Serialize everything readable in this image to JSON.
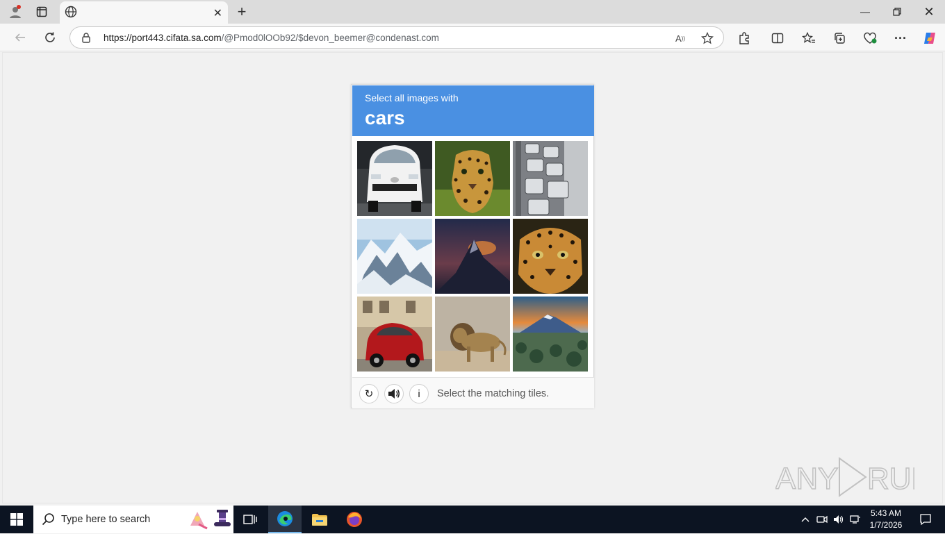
{
  "browser": {
    "tab_title": "",
    "url_host": "https://port443.cifata.sa.com",
    "url_path": "/@Pmod0lOOb92/$devon_beemer@condenast.com"
  },
  "captcha": {
    "prompt_line1": "Select all images with",
    "prompt_target": "cars",
    "footer_message": "Select the matching tiles.",
    "refresh_glyph": "↻",
    "info_glyph": "i",
    "tiles": [
      {
        "subject": "white car"
      },
      {
        "subject": "leopard"
      },
      {
        "subject": "traffic jam"
      },
      {
        "subject": "snowy mountains"
      },
      {
        "subject": "mountain peak at dusk"
      },
      {
        "subject": "leopard face"
      },
      {
        "subject": "red car"
      },
      {
        "subject": "lion"
      },
      {
        "subject": "mountain at sunset"
      }
    ],
    "header_color": "#4a90e2"
  },
  "watermark": "ANY RUN",
  "taskbar": {
    "search_placeholder": "Type here to search",
    "time": "5:43 AM",
    "date": "1/7/2026"
  }
}
